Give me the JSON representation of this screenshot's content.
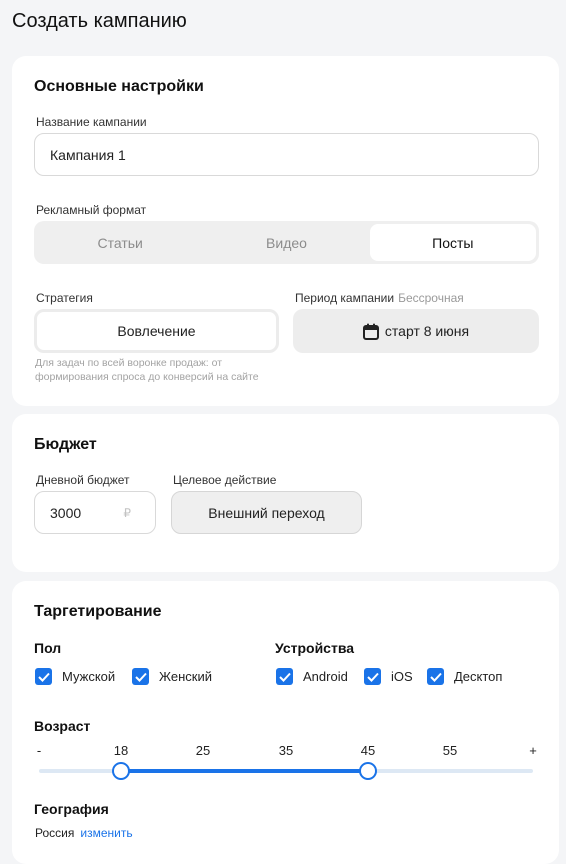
{
  "page": {
    "title": "Создать кампанию"
  },
  "basic": {
    "title": "Основные настройки",
    "name_label": "Название кампании",
    "name_value": "Кампания 1",
    "format_label": "Рекламный формат",
    "formats": [
      "Статьи",
      "Видео",
      "Посты"
    ],
    "format_selected": "Посты",
    "strategy_label": "Стратегия",
    "strategy_value": "Вовлечение",
    "strategy_hint_line1": "Для задач по всей воронке продаж: от",
    "strategy_hint_line2": "формирования спроса до конверсий на сайте",
    "period_label": "Период кампании",
    "period_muted": "Бессрочная",
    "period_value": "старт 8 июня",
    "period_icon": "calendar-icon"
  },
  "budget": {
    "title": "Бюджет",
    "daily_label": "Дневной бюджет",
    "daily_value": "3000",
    "currency": "₽",
    "target_label": "Целевое действие",
    "target_value": "Внешний переход"
  },
  "targeting": {
    "title": "Таргетирование",
    "gender_label": "Пол",
    "gender": [
      {
        "label": "Мужской",
        "checked": true
      },
      {
        "label": "Женский",
        "checked": true
      }
    ],
    "devices_label": "Устройства",
    "devices": [
      {
        "label": "Android",
        "checked": true
      },
      {
        "label": "iOS",
        "checked": true
      },
      {
        "label": "Десктоп",
        "checked": true
      }
    ],
    "age_label": "Возраст",
    "age_ticks": [
      "-",
      "18",
      "25",
      "35",
      "45",
      "55",
      "+"
    ],
    "age_range": {
      "min": "18",
      "max": "45"
    },
    "geo_label": "География",
    "geo_value": "Россия",
    "geo_change": "изменить"
  },
  "colors": {
    "accent": "#1a73e8",
    "card": "#ffffff",
    "background": "#f4f5f7"
  }
}
